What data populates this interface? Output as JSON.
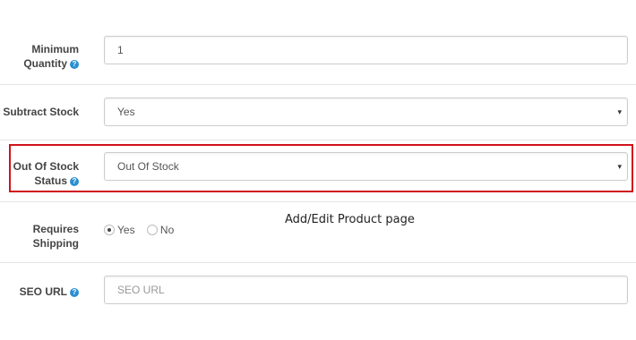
{
  "form": {
    "minimum_quantity": {
      "label_line1": "Minimum",
      "label_line2": "Quantity",
      "value": "1"
    },
    "subtract_stock": {
      "label": "Subtract Stock",
      "value": "Yes"
    },
    "out_of_stock_status": {
      "label_line1": "Out Of Stock",
      "label_line2": "Status",
      "value": "Out Of Stock"
    },
    "requires_shipping": {
      "label_line1": "Requires",
      "label_line2": "Shipping",
      "options": [
        {
          "label": "Yes",
          "checked": true
        },
        {
          "label": "No",
          "checked": false
        }
      ]
    },
    "seo_url": {
      "label": "SEO URL",
      "placeholder": "SEO URL"
    }
  },
  "help_glyph": "?",
  "select_arrow_glyph": "▾",
  "caption": "Add/Edit Product page",
  "icons": {
    "help": "question-circle-icon",
    "dropdown": "caret-down-icon"
  },
  "colors": {
    "highlight": "#d0121b",
    "help_icon": "#2a8fd1"
  }
}
